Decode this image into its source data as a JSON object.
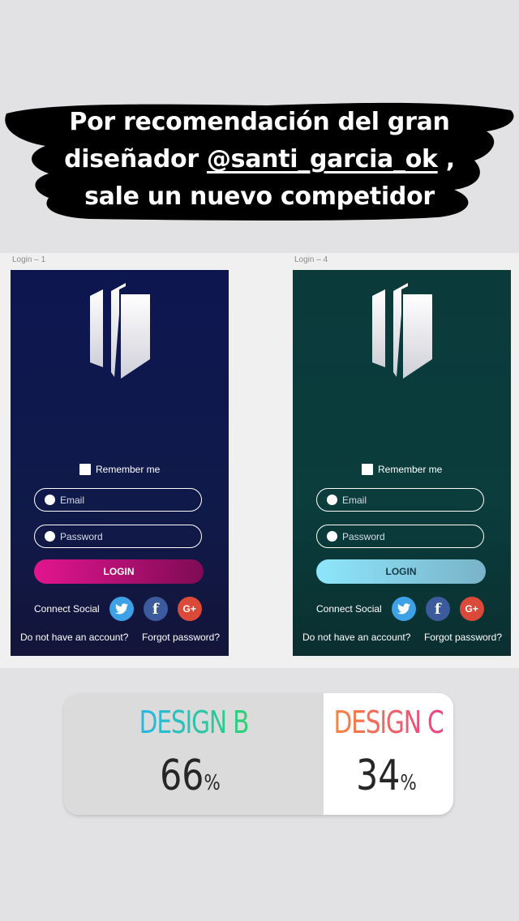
{
  "caption": {
    "line1": "Por recomendación del gran",
    "line2_pre": "diseñador ",
    "line2_link": "@santi_garcia_ok",
    "line2_post": " ,",
    "line3": "sale un nuevo competidor"
  },
  "artboards": [
    {
      "label": "Login – 1",
      "remember": "Remember me",
      "email_placeholder": "Email",
      "password_placeholder": "Password",
      "login_button": "LOGIN",
      "connect_social": "Connect Social",
      "no_account": "Do not have an account?",
      "forgot": "Forgot password?"
    },
    {
      "label": "Login – 4",
      "remember": "Remember me",
      "email_placeholder": "Email",
      "password_placeholder": "Password",
      "login_button": "LOGIN",
      "connect_social": "Connect Social",
      "no_account": "Do not have an account?",
      "forgot": "Forgot password?"
    }
  ],
  "social_icons": [
    "twitter-icon",
    "facebook-icon",
    "google-plus-icon"
  ],
  "poll": {
    "option_b": {
      "label": "DESIGN B",
      "percent": "66",
      "unit": "%"
    },
    "option_c": {
      "label": "DESIGN C",
      "percent": "34",
      "unit": "%"
    },
    "colors": {
      "b_start": "#25b5f0",
      "b_end": "#2fd36a",
      "c_start": "#f78a3b",
      "c_end": "#ec3c8c"
    }
  }
}
